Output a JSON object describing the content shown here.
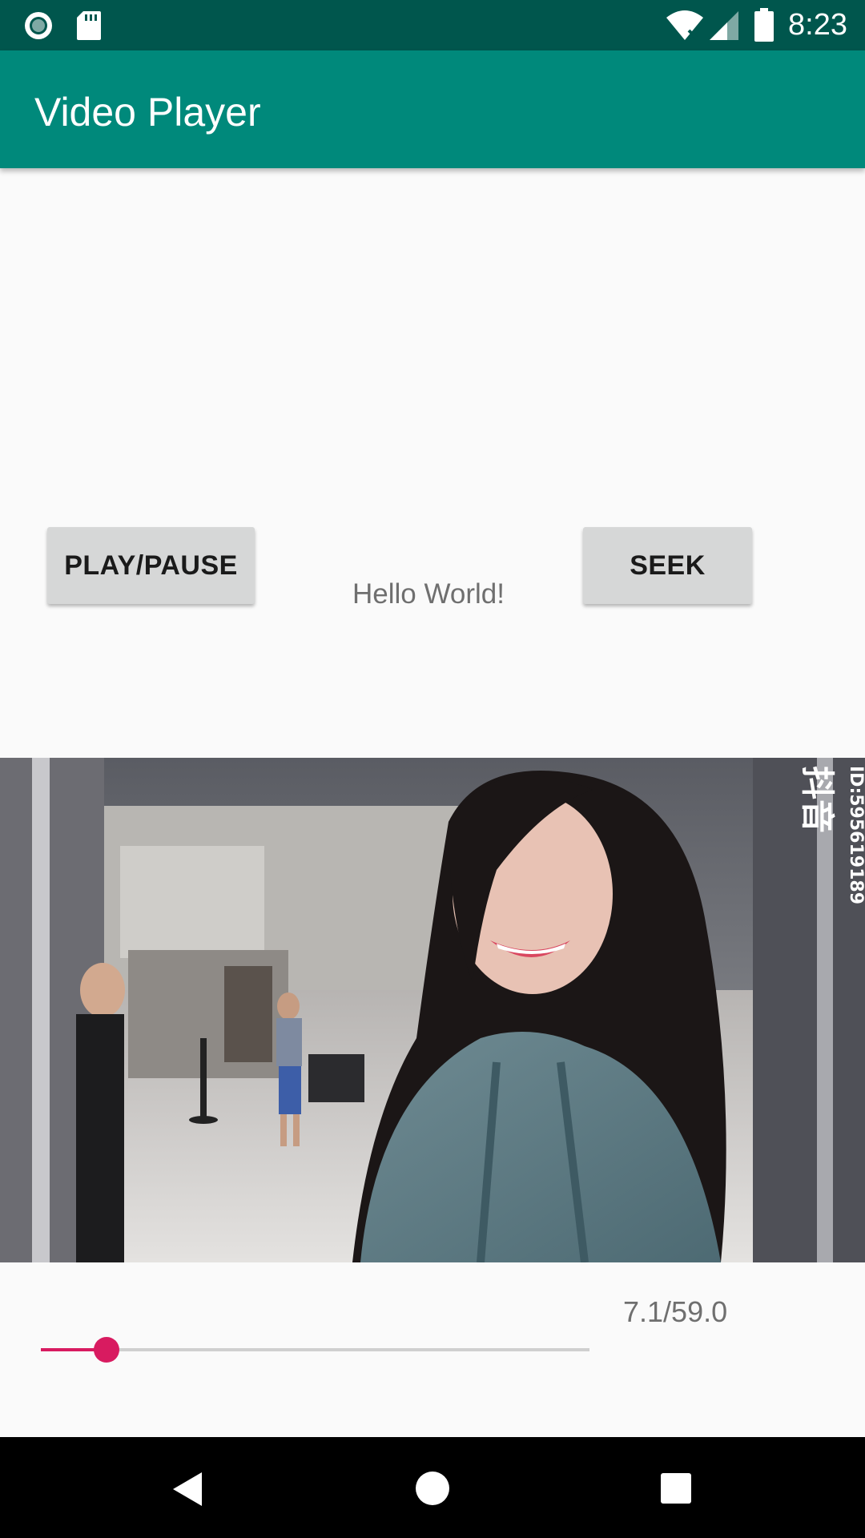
{
  "status_bar": {
    "time": "8:23",
    "icons": [
      "record-icon",
      "sd-card-icon",
      "wifi-icon",
      "signal-icon",
      "battery-icon"
    ]
  },
  "app_bar": {
    "title": "Video Player"
  },
  "controls": {
    "play_pause_label": "PLAY/PAUSE",
    "seek_label": "SEEK",
    "hello_text": "Hello World!"
  },
  "video": {
    "watermark_id": "ID:595619189",
    "watermark_logo": "抖音"
  },
  "playback": {
    "time_text": "7.1/59.0",
    "current_seconds": 7.1,
    "total_seconds": 59.0,
    "accent_color": "#d81b60"
  },
  "nav_bar": {
    "icons": [
      "back-icon",
      "home-icon",
      "recents-icon"
    ]
  },
  "colors": {
    "app_bar": "#00897b",
    "status_bar": "#00564d",
    "background": "#fafafa"
  }
}
